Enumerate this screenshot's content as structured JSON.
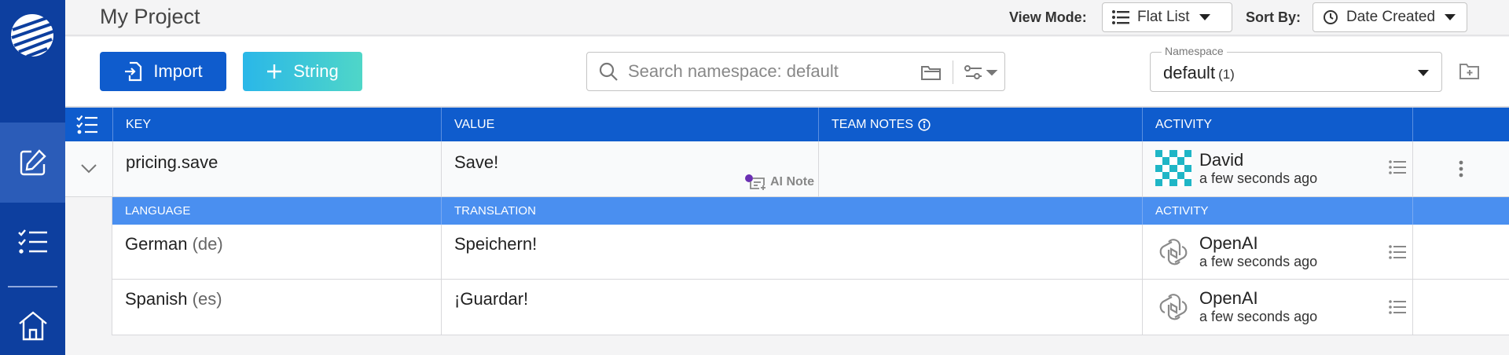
{
  "header": {
    "project_title": "My Project",
    "view_mode_label": "View Mode:",
    "view_mode_value": "Flat List",
    "sort_by_label": "Sort By:",
    "sort_by_value": "Date Created"
  },
  "toolbar": {
    "import_label": "Import",
    "string_label": "String",
    "search_placeholder": "Search namespace: default",
    "namespace_label": "Namespace",
    "namespace_value": "default",
    "namespace_count": "(1)"
  },
  "table": {
    "columns": {
      "key": "KEY",
      "value": "VALUE",
      "team_notes": "TEAM NOTES",
      "activity": "ACTIVITY"
    },
    "main_row": {
      "key": "pricing.save",
      "value": "Save!",
      "ai_note": "AI Note",
      "activity_name": "David",
      "activity_time": "a few seconds ago"
    },
    "sub_columns": {
      "language": "LANGUAGE",
      "translation": "TRANSLATION",
      "activity": "ACTIVITY"
    },
    "translations": [
      {
        "language": "German",
        "code": "(de)",
        "translation": "Speichern!",
        "activity_name": "OpenAI",
        "activity_time": "a few seconds ago"
      },
      {
        "language": "Spanish",
        "code": "(es)",
        "translation": "¡Guardar!",
        "activity_name": "OpenAI",
        "activity_time": "a few seconds ago"
      }
    ]
  },
  "colors": {
    "sidebar": "#0d3f9f",
    "primary": "#0f5ccd",
    "subheader": "#4a8ff0",
    "ai_dot": "#6b2fb3",
    "avatar_teal": "#1fb6c6"
  }
}
